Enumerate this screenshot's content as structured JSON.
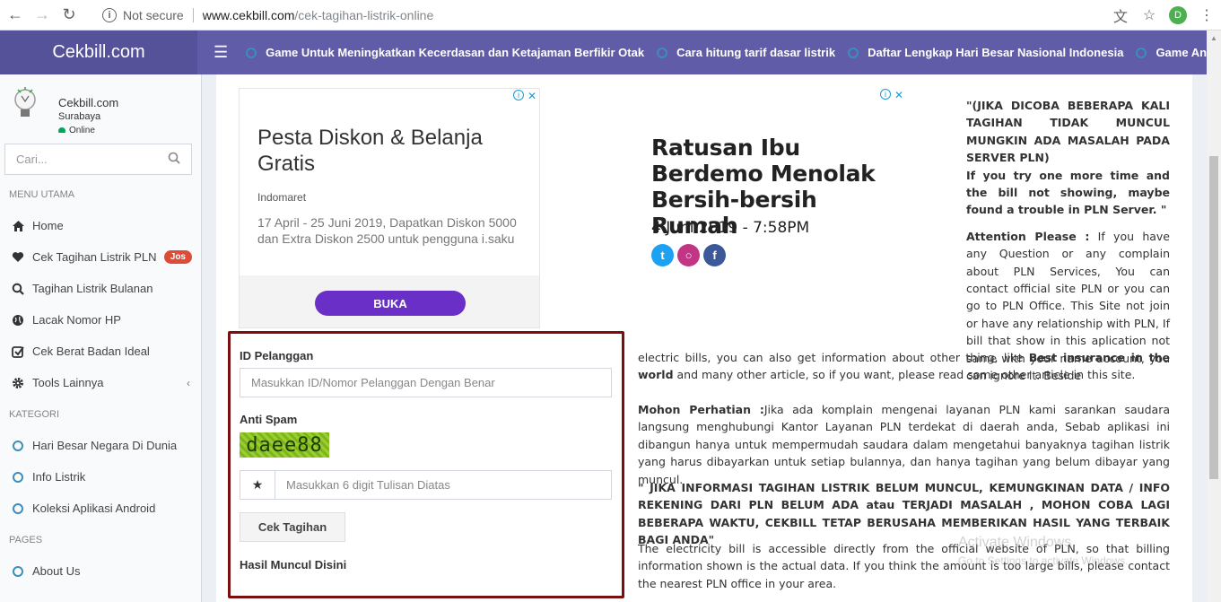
{
  "browser": {
    "security": "Not secure",
    "url_host": "www.cekbill.com",
    "url_path": "/cek-tagihan-listrik-online",
    "profile_initial": "D"
  },
  "header": {
    "brand": "Cekbill.com",
    "ticker": [
      "Game Untuk Meningkatkan Kecerdasan dan Ketajaman Berfikir Otak",
      "Cara hitung tarif dasar listrik",
      "Daftar Lengkap Hari Besar Nasional Indonesia",
      "Game Android Jelek"
    ]
  },
  "sidebar": {
    "user_name": "Cekbill.com",
    "user_city": "Surabaya",
    "user_status": "Online",
    "search_placeholder": "Cari...",
    "menu_header": "MENU UTAMA",
    "menu": [
      {
        "label": "Home",
        "icon": "home-icon"
      },
      {
        "label": "Cek Tagihan Listrik PLN",
        "icon": "heart-icon",
        "badge": "Jos"
      },
      {
        "label": "Tagihan Listrik Bulanan",
        "icon": "search-icon"
      },
      {
        "label": "Lacak Nomor HP",
        "icon": "globe-icon"
      },
      {
        "label": "Cek Berat Badan Ideal",
        "icon": "check-square-icon"
      },
      {
        "label": "Tools Lainnya",
        "icon": "cog-icon"
      }
    ],
    "kategori_header": "KATEGORI",
    "kategori": [
      "Hari Besar Negara Di Dunia",
      "Info Listrik",
      "Koleksi Aplikasi Android"
    ],
    "pages_header": "PAGES",
    "pages": [
      "About Us"
    ]
  },
  "ad_left": {
    "title": "Pesta Diskon & Belanja Gratis",
    "brand": "Indomaret",
    "desc": "17 April - 25 Juni 2019, Dapatkan Diskon 5000 dan Extra Diskon 2500 untuk pengguna i.saku",
    "button": "BUKA"
  },
  "ad_right": {
    "headline": "Ratusan Ibu Berdemo Menolak Bersih-bersih Rumah",
    "date": "4 Juni 2019 - 7:58PM"
  },
  "form": {
    "id_label": "ID Pelanggan",
    "id_placeholder": "Masukkan ID/Nomor Pelanggan Dengan Benar",
    "spam_label": "Anti Spam",
    "captcha": "daee88",
    "captcha_placeholder": "Masukkan 6 digit Tulisan Diatas",
    "submit": "Cek Tagihan",
    "result_label": "Hasil Muncul Disini"
  },
  "article": {
    "warn_id": "\"(JIKA DICOBA BEBERAPA KALI TAGIHAN TIDAK MUNCUL MUNGKIN ADA MASALAH PADA SERVER PLN)",
    "warn_en": "If you try one more time and the bill not showing, maybe found a trouble in PLN Server. \"",
    "attention_label": "Attention Please :",
    "attention_text": " If you have any Question or any complain about PLN Services, You can contact official site PLN or you can go to PLN Office. This Site not join or have any relationship with PLN, If bill that show in this aplication not same with your name account, you can ignore it. Beside",
    "attention_cont_1": "electric bills, you can also get information about other thing, like ",
    "attention_bold": "Best insurance in the world",
    "attention_cont_2": " and many other article, so if you want, please read some other article in this site.",
    "mohon_label": "Mohon Perhatian :",
    "mohon_text": "Jika ada komplain mengenai layanan PLN kami sarankan saudara langsung menghubungi Kantor Layanan PLN terdekat di daerah anda, Sebab aplikasi ini dibangun hanya untuk mempermudah saudara dalam mengetahui banyaknya tagihan listrik yang harus dibayarkan untuk setiap bulannya, dan hanya tagihan yang belum dibayar yang muncul.",
    "warn2": "\" JIKA INFORMASI TAGIHAN LISTRIK BELUM MUNCUL, KEMUNGKINAN DATA / INFO REKENING DARI PLN BELUM ADA atau TERJADI MASALAH , MOHON COBA LAGI BEBERAPA WAKTU, CEKBILL TETAP BERUSAHA MEMBERIKAN HASIL YANG TERBAIK BAGI ANDA\"",
    "electricity": "The electricity bill is accessible directly from the official website of PLN, so that billing information shown is the actual data. If you think the amount is too large bills, please contact the nearest PLN office in your area."
  },
  "watermark": {
    "title": "Activate Windows",
    "sub": "Go to Settings to activate Windows."
  },
  "colors": {
    "header": "#605ca8",
    "brand_bg": "#555299",
    "badge": "#dd4b39",
    "form_border": "#7a1010",
    "ad_button": "#6a2fc6"
  }
}
